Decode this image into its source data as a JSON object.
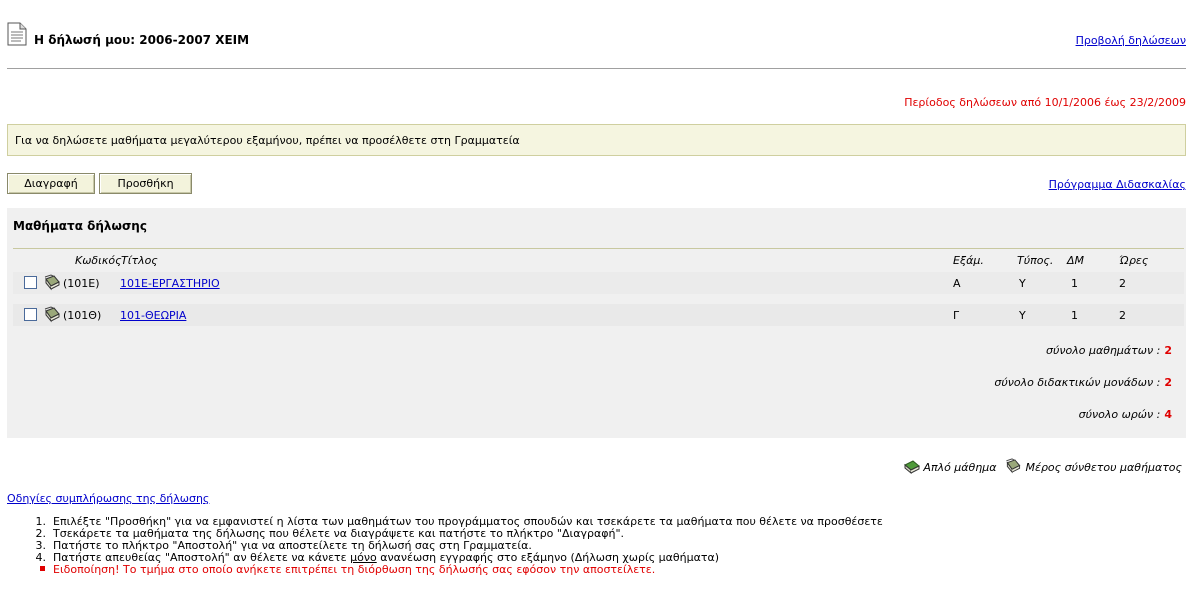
{
  "header": {
    "title": "Η δήλωσή μου: 2006-2007 ΧΕΙΜ",
    "view_link": "Προβολή δηλώσεων",
    "period": "Περίοδος δηλώσεων από 10/1/2006 έως 23/2/2009"
  },
  "notice": "Για να δηλώσετε μαθήματα μεγαλύτερου εξαμήνου, πρέπει να προσέλθετε στη Γραμματεία",
  "toolbar": {
    "delete_label": "Διαγραφή",
    "add_label": "Προσθήκη",
    "program_link": "Πρόγραμμα Διδασκαλίας"
  },
  "courses": {
    "title": "Μαθήματα δήλωσης",
    "columns": {
      "code": "Κωδικός",
      "title": "Τίτλος",
      "semester": "Εξάμ.",
      "type": "Τύπος.",
      "dm": "ΔΜ",
      "hours": "Ώρες"
    },
    "rows": [
      {
        "code": "(101Ε)",
        "title": "101Ε-ΕΡΓΑΣΤΗΡΙΟ",
        "semester": "Α",
        "type": "Υ",
        "dm": "1",
        "hours": "2",
        "checked": false
      },
      {
        "code": "(101Θ)",
        "title": "101-ΘΕΩΡΙΑ",
        "semester": "Γ",
        "type": "Υ",
        "dm": "1",
        "hours": "2",
        "checked": false
      }
    ],
    "totals": {
      "courses_label": "σύνολο μαθημάτων :",
      "courses_value": "2",
      "units_label": "σύνολο διδακτικών μονάδων :",
      "units_value": "2",
      "hours_label": "σύνολο ωρών :",
      "hours_value": "4"
    }
  },
  "legend": {
    "simple": "Απλό μάθημα",
    "composite": "Μέρος σύνθετου μαθήματος"
  },
  "instructions": {
    "link": "Οδηγίες συμπλήρωσης της δήλωσης",
    "steps": [
      {
        "num": "1.",
        "text": "Επιλέξτε \"Προσθήκη\" για να εμφανιστεί η λίστα των μαθημάτων του προγράμματος σπουδών και τσεκάρετε τα μαθήματα που θέλετε να προσθέσετε"
      },
      {
        "num": "2.",
        "text": "Τσεκάρετε τα μαθήματα της δήλωσης που θέλετε να διαγράψετε και πατήστε το πλήκτρο \"Διαγραφή\"."
      },
      {
        "num": "3.",
        "text": "Πατήστε το πλήκτρο \"Αποστολή\" για να αποστείλετε τη δήλωσή σας στη Γραμματεία."
      }
    ],
    "step4": {
      "num": "4.",
      "before": "Πατήστε απευθείας \"Αποστολή\" αν θέλετε να κάνετε ",
      "underlined": "μόνο",
      "after": " ανανέωση εγγραφής στο εξάμηνο (Δήλωση χωρίς μαθήματα)"
    },
    "warning": "Ειδοποίηση! Το τμήμα στο οποίο ανήκετε επιτρέπει τη διόρθωση της δήλωσής σας εφόσον την αποστείλετε."
  },
  "colors": {
    "warning_red": "#e00000",
    "link_blue": "#0000cc",
    "notice_bg": "#f5f5e0",
    "table_bg": "#f0f0f0"
  }
}
